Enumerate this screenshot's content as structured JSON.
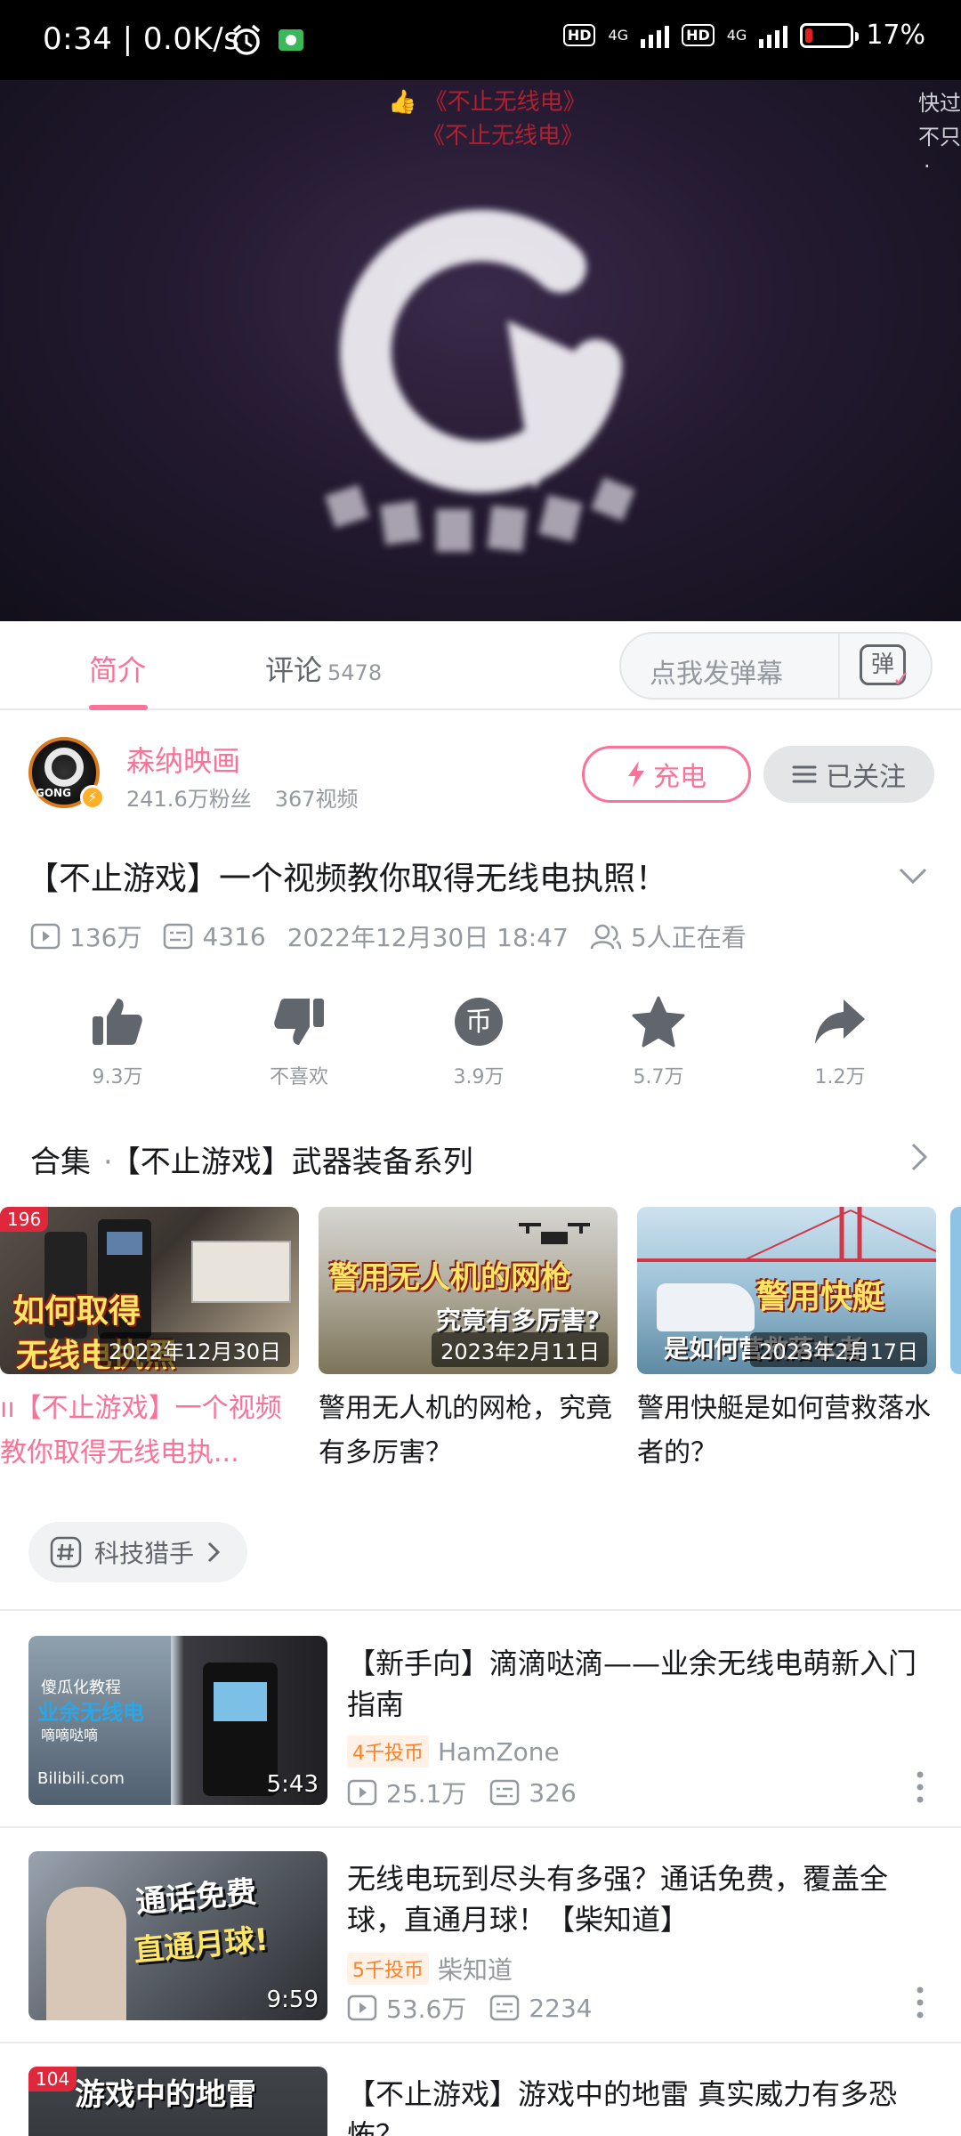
{
  "status_bar": {
    "time": "0:34 | 0.0K/s",
    "network_1": "4G",
    "network_2": "4G",
    "hd_1": "HD",
    "hd_2": "HD",
    "battery": "17%",
    "battery_level": 0.17,
    "icons": [
      "alarm-icon",
      "wallet-icon",
      "signal-icon",
      "battery-icon"
    ]
  },
  "player": {
    "danmaku": [
      "《不止无线电》",
      "《不止无线电》"
    ],
    "side_text": [
      "快过",
      "不只",
      "."
    ]
  },
  "tabs": {
    "intro": "简介",
    "comments": "评论",
    "comments_count": "5478",
    "danmaku_placeholder": "点我发弹幕",
    "danmaku_icon_char": "弹"
  },
  "uploader": {
    "name": "森纳映画",
    "fans": "241.6万粉丝",
    "videos": "367视频",
    "avatar_text": "GONG",
    "charge_label": "充电",
    "follow_label": "已关注"
  },
  "video": {
    "title": "【不止游戏】一个视频教你取得无线电执照！",
    "views": "136万",
    "danmaku_count": "4316",
    "date": "2022年12月30日 18:47",
    "watching": "5人正在看"
  },
  "actions": [
    {
      "label": "9.3万",
      "icon": "like-icon"
    },
    {
      "label": "不喜欢",
      "icon": "dislike-icon"
    },
    {
      "label": "3.9万",
      "icon": "coin-icon",
      "glyph": "币"
    },
    {
      "label": "5.7万",
      "icon": "favorite-icon"
    },
    {
      "label": "1.2万",
      "icon": "share-icon"
    }
  ],
  "collection": {
    "label": "合集",
    "dot": "·",
    "name": "【不止游戏】武器装备系列"
  },
  "collection_items": [
    {
      "badge": "196",
      "thumb_big": "如何取得",
      "thumb_big2": "无线电执照",
      "date": "2022年12月30日",
      "title": "【不止游戏】一个视频教你取得无线电执..."
    },
    {
      "thumb_big": "警用无人机的网枪",
      "thumb_small": "究竟有多厉害?",
      "date": "2023年2月11日",
      "title": "警用无人机的网枪，究竟有多厉害？"
    },
    {
      "thumb_big": "警用快艇",
      "thumb_small": "是如何营救落水者",
      "date": "2023年2月17日",
      "title": "警用快艇是如何营救落水者的？"
    }
  ],
  "tag": {
    "label": "科技猎手"
  },
  "recommendations": [
    {
      "title": "【新手向】滴滴哒滴——业余无线电萌新入门指南",
      "coin": "4千投币",
      "uploader": "HamZone",
      "views": "25.1万",
      "danmaku": "326",
      "duration": "5:43",
      "thumb_texts": [
        "傻瓜化教程",
        "业余无线电",
        "嘀嘀哒嘀",
        "Bilibili.com"
      ]
    },
    {
      "title": "无线电玩到尽头有多强？通话免费，覆盖全球，直通月球！【柴知道】",
      "coin": "5千投币",
      "uploader": "柴知道",
      "views": "53.6万",
      "danmaku": "2234",
      "duration": "9:59",
      "thumb_texts": [
        "通话免费",
        "直通月球!"
      ]
    },
    {
      "title": "【不止游戏】游戏中的地雷 真实威力有多恐怖？",
      "badge": "104",
      "thumb_texts": [
        "游戏中的地雷"
      ]
    }
  ]
}
